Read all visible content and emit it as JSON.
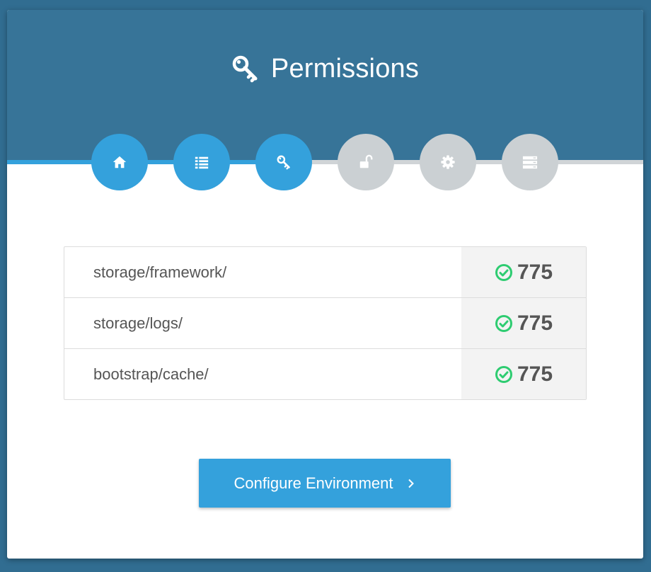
{
  "header": {
    "title": "Permissions",
    "title_icon": "key-icon"
  },
  "steps": [
    {
      "name": "home",
      "icon": "home-icon",
      "state": "completed"
    },
    {
      "name": "requirements",
      "icon": "list-icon",
      "state": "completed"
    },
    {
      "name": "permissions",
      "icon": "key-icon",
      "state": "current"
    },
    {
      "name": "environment",
      "icon": "unlock-icon",
      "state": "upcoming"
    },
    {
      "name": "settings",
      "icon": "gear-icon",
      "state": "upcoming"
    },
    {
      "name": "server",
      "icon": "server-icon",
      "state": "upcoming"
    }
  ],
  "progress": {
    "fraction": 0.47
  },
  "permissions": [
    {
      "folder": "storage/framework/",
      "value": "775",
      "status": "ok"
    },
    {
      "folder": "storage/logs/",
      "value": "775",
      "status": "ok"
    },
    {
      "folder": "bootstrap/cache/",
      "value": "775",
      "status": "ok"
    }
  ],
  "action": {
    "label": "Configure Environment",
    "icon": "chevron-right-icon"
  },
  "colors": {
    "page_background": "#316d91",
    "header": "#377498",
    "accent": "#34a1dc",
    "inactive_step": "#cbd0d3",
    "success": "#2ecc71",
    "text": "#555555"
  }
}
